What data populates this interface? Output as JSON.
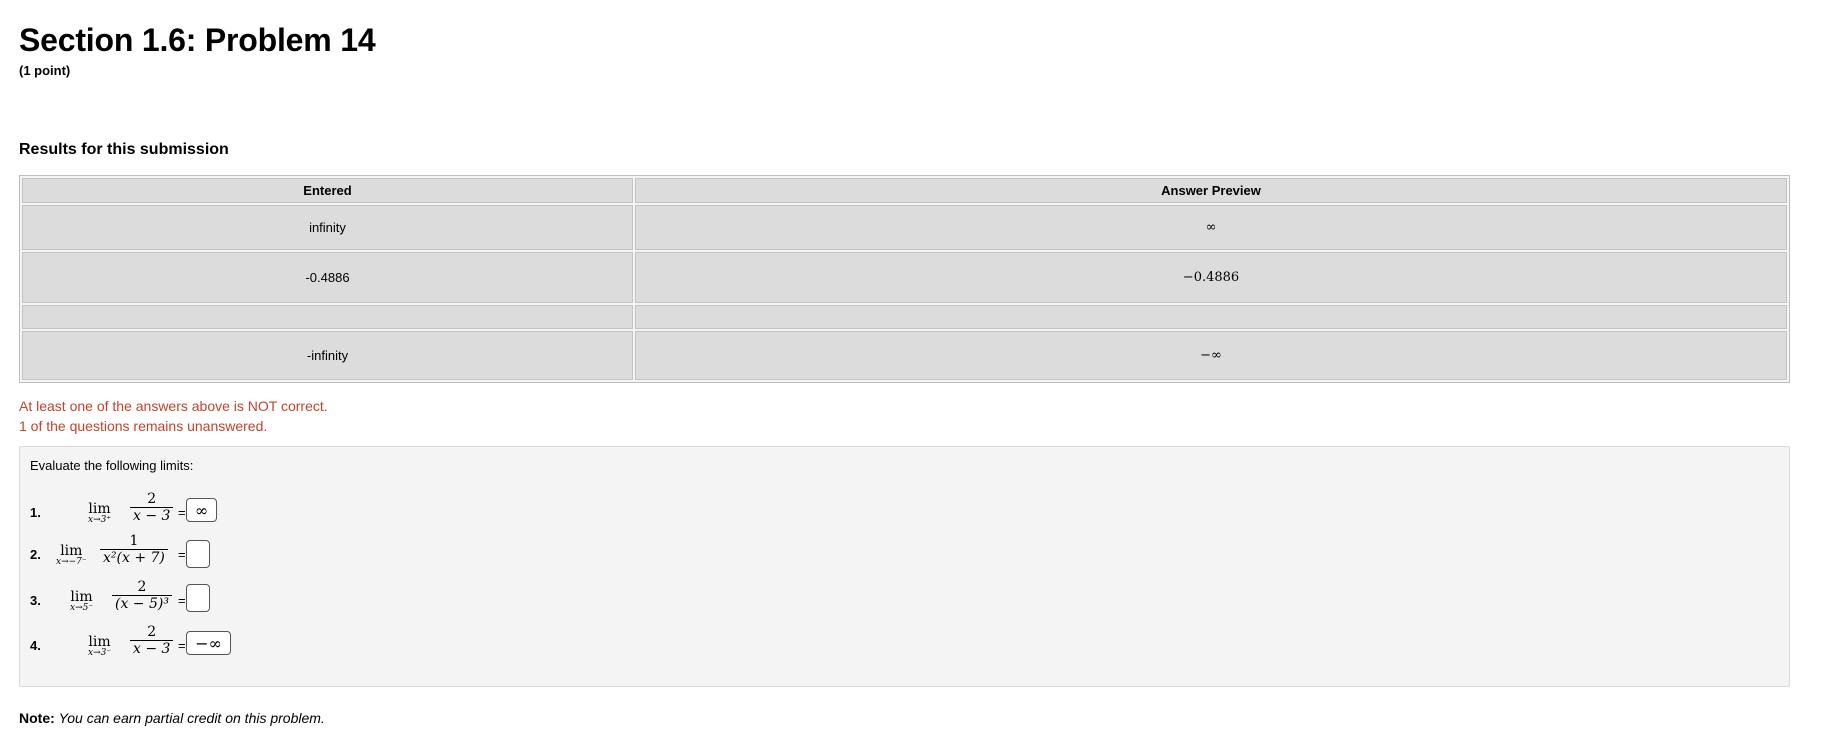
{
  "header": {
    "title": "Section 1.6: Problem 14",
    "points": "(1 point)"
  },
  "results": {
    "title": "Results for this submission",
    "columns": [
      "Entered",
      "Answer Preview"
    ],
    "rows": [
      {
        "entered": "infinity",
        "preview": "∞"
      },
      {
        "entered": "-0.4886",
        "preview": "−0.4886"
      },
      {
        "entered": "",
        "preview": ""
      },
      {
        "entered": "-infinity",
        "preview": "−∞"
      }
    ]
  },
  "messages": {
    "incorrect": "At least one of the answers above is NOT correct.",
    "unanswered": "1 of the questions remains unanswered."
  },
  "problem": {
    "intro": "Evaluate the following limits:",
    "items": [
      {
        "number": "1.",
        "lim": "lim",
        "approach": "x→3⁺",
        "numerator": "2",
        "denominator": "x − 3",
        "equals": "=",
        "answer": "∞"
      },
      {
        "number": "2.",
        "lim": "lim",
        "approach": "x→−7⁻",
        "numerator": "1",
        "denominator": "x²(x + 7)",
        "equals": "=",
        "answer": ""
      },
      {
        "number": "3.",
        "lim": "lim",
        "approach": "x→5⁻",
        "numerator": "2",
        "denominator": "(x − 5)³",
        "equals": "=",
        "answer": ""
      },
      {
        "number": "4.",
        "lim": "lim",
        "approach": "x→3⁻",
        "numerator": "2",
        "denominator": "x − 3",
        "equals": "=",
        "answer": "−∞"
      }
    ]
  },
  "note": {
    "label": "Note:",
    "text": "You can earn partial credit on this problem."
  },
  "colors": {
    "error_text": "#c1442b",
    "table_cell": "#dcdcdc",
    "problem_bg": "#f4f4f4"
  }
}
